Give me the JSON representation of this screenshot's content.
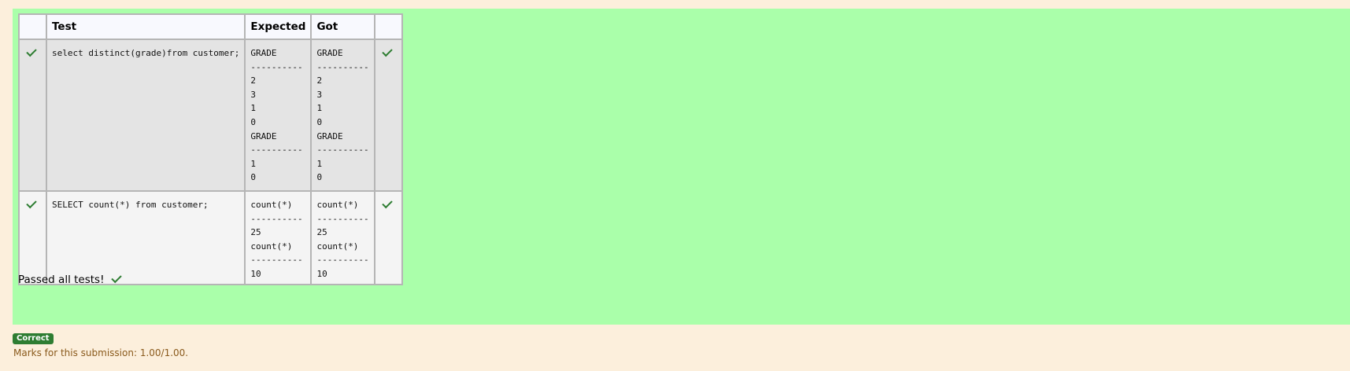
{
  "table": {
    "headers": [
      "",
      "Test",
      "Expected",
      "Got",
      ""
    ],
    "rows": [
      {
        "test": "select distinct(grade)from customer;",
        "expected": [
          "GRADE",
          "----------",
          "2",
          "3",
          "1",
          "0",
          "GRADE",
          "----------",
          "1",
          "0"
        ],
        "got": [
          "GRADE",
          "----------",
          "2",
          "3",
          "1",
          "0",
          "GRADE",
          "----------",
          "1",
          "0"
        ],
        "status_icon": "check-icon",
        "passed": true
      },
      {
        "test": "SELECT count(*) from customer;",
        "expected": [
          "count(*)",
          "----------",
          "25",
          "count(*)",
          "----------",
          "10"
        ],
        "got": [
          "count(*)",
          "----------",
          "25",
          "count(*)",
          "----------",
          "10"
        ],
        "status_icon": "check-icon",
        "passed": true
      }
    ]
  },
  "summary": {
    "passed_text": "Passed all tests!",
    "icon": "check-icon"
  },
  "result": {
    "badge": "Correct",
    "marks": "Marks for this submission: 1.00/1.00."
  },
  "colors": {
    "panel_bg": "#aaffaa",
    "page_bg": "#fcefdc",
    "check": "#2e7d32",
    "badge_bg": "#2e7d32",
    "marks_text": "#8a5a1c"
  }
}
